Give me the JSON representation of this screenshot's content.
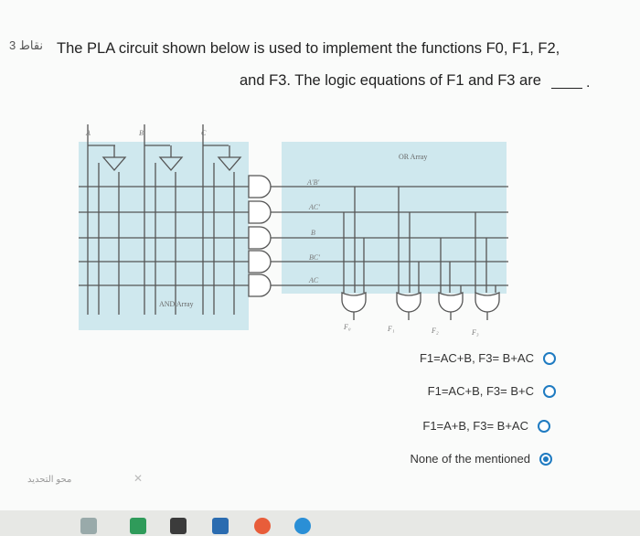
{
  "question": {
    "number": "3 نقاط",
    "line1": "The PLA circuit shown below is used to implement the functions F0, F1, F2,",
    "line2": "and F3. The logic equations of F1 and F3 are"
  },
  "figure": {
    "inputs": [
      "A",
      "B",
      "C"
    ],
    "terms": [
      "A'B'",
      "AC'",
      "B",
      "BC'",
      "AC"
    ],
    "or_label": "OR Array",
    "and_label": "AND Array",
    "outputs": [
      "F₀",
      "F₁",
      "F₂",
      "F₃"
    ]
  },
  "options": [
    {
      "label": "F1=AC+B, F3= B+AC",
      "selected": false
    },
    {
      "label": "F1=AC+B, F3= B+C",
      "selected": false
    },
    {
      "label": "F1=A+B, F3= B+AC",
      "selected": false
    },
    {
      "label": "None of the mentioned",
      "selected": true
    }
  ],
  "clear_label": "محو التحديد",
  "colors": {
    "accent": "#1f7bc1",
    "array_fill": "#cfe8ee"
  }
}
